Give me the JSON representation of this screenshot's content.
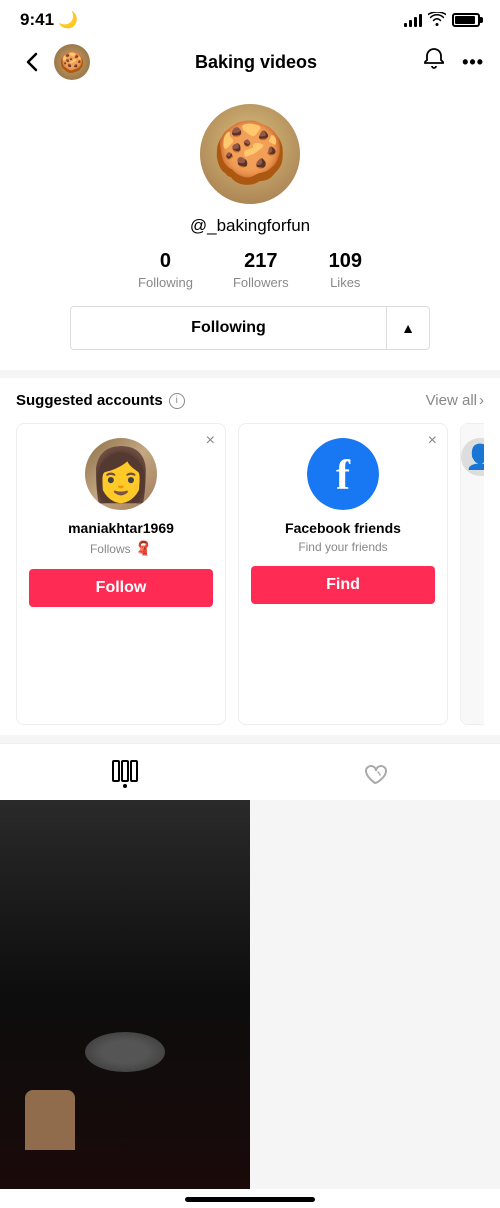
{
  "statusBar": {
    "time": "9:41",
    "moon": "🌙"
  },
  "navBar": {
    "title": "Baking videos",
    "backLabel": "<",
    "bellLabel": "🔔",
    "moreLabel": "•••"
  },
  "profile": {
    "username": "@_bakingforfun",
    "stats": {
      "following": {
        "number": "0",
        "label": "Following"
      },
      "followers": {
        "number": "217",
        "label": "Followers"
      },
      "likes": {
        "number": "109",
        "label": "Likes"
      }
    },
    "followingButton": "Following",
    "dropdownArrow": "▲"
  },
  "suggested": {
    "title": "Suggested accounts",
    "infoIcon": "i",
    "viewAll": "View all",
    "chevron": "›",
    "cards": [
      {
        "name": "maniakhtar1969",
        "sub": "Follows",
        "emoji": "🧣",
        "followBtn": "Follow"
      },
      {
        "name": "Facebook friends",
        "sub": "Find your friends",
        "followBtn": "Find"
      }
    ]
  },
  "tabBar": {
    "gridIcon": "⊞",
    "heartIcon": "♡"
  },
  "homeIndicator": ""
}
